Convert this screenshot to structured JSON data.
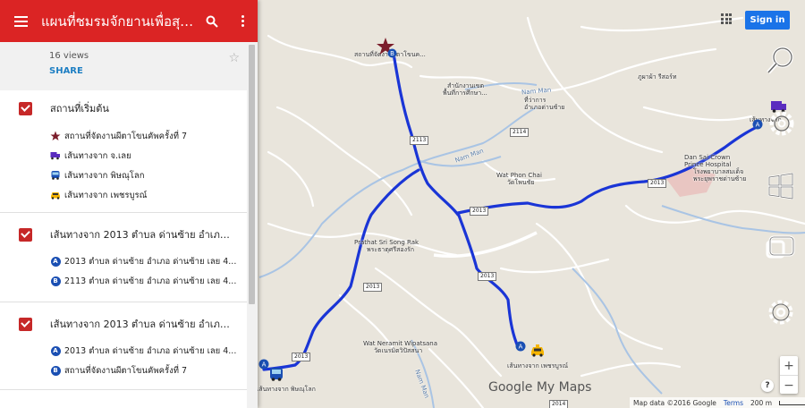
{
  "header": {
    "title": "แผนที่ชมรมจักยานเพื่อสุข...",
    "views": "16 views",
    "share": "SHARE"
  },
  "layers": [
    {
      "name": "สถานที่เริ่มต้น",
      "items": [
        {
          "label": "สถานที่จัดงานผีตาโขนคัพครั้งที่ 7",
          "icon": "star-icon"
        },
        {
          "label": "เส้นทางจาก จ.เลย",
          "icon": "truck-icon"
        },
        {
          "label": "เส้นทางจาก พิษณุโลก",
          "icon": "bus-icon"
        },
        {
          "label": "เส้นทางจาก เพชรบูรณ์",
          "icon": "taxi-icon"
        }
      ]
    },
    {
      "name": "เส้นทางจาก 2013 ตำบล ด่านซ้าย อำเภอ ...",
      "items": [
        {
          "badge": "A",
          "label": "2013 ตำบล ด่านซ้าย อำเภอ ด่านซ้าย เลย 4..."
        },
        {
          "badge": "B",
          "label": "2113 ตำบล ด่านซ้าย อำเภอ ด่านซ้าย เลย 4..."
        }
      ]
    },
    {
      "name": "เส้นทางจาก 2013 ตำบล ด่านซ้าย อำเภอ ...",
      "items": [
        {
          "badge": "A",
          "label": "2013 ตำบล ด่านซ้าย อำเภอ ด่านซ้าย เลย 4..."
        },
        {
          "badge": "B",
          "label": "สถานที่จัดงานผีตาโขนคัพครั้งที่ 7"
        }
      ]
    }
  ],
  "map": {
    "labels": {
      "venue": "สถานที่จัดงานผีตาโขนค...",
      "district_office_1": "สำนักงานเขต",
      "district_office_2": "พื้นที่การศึกษา...",
      "amphoe_1": "ที่ว่าการ",
      "amphoe_2": "อำเภอด่านซ้าย",
      "nam_man_1": "Nam Man",
      "nam_man_2": "Nam Man",
      "wat_phon_chai_1": "Wat Phon Chai",
      "wat_phon_chai_2": "วัดโพนชัย",
      "prathat_1": "Prathat Sri Song Rak",
      "prathat_2": "พระธาตุศรีสองรัก",
      "hospital_1": "Dan Sai Crown",
      "hospital_2": "Prince Hospital",
      "hospital_3": "โรงพยาบาลสมเด็จ",
      "hospital_4": "พระยุพราชด่านซ้าย",
      "wat_neramit_1": "Wat Neramit Wipatsana",
      "wat_neramit_2": "วัดเนรมิตวิปัสสนา",
      "phu_pha": "ภูผาผ้า รีสอร์ท",
      "route_loei": "เส้นทางจาก",
      "route_phitsanulok": "เส้นทางจาก พิษณุโลก",
      "route_phetchabun": "เส้นทางจาก เพชรบูรณ์",
      "nam_man_3": "Nam Man"
    },
    "shields": [
      "2113",
      "2114",
      "2013",
      "2013",
      "2013",
      "2013",
      "2013",
      "2014"
    ],
    "route_color": "#1a35d6",
    "brand": "Google My Maps"
  },
  "controls": {
    "sign_in": "Sign in",
    "zoom_in": "+",
    "zoom_out": "−",
    "help": "?"
  },
  "attribution": {
    "data": "Map data ©2016 Google",
    "terms": "Terms",
    "scale": "200 m"
  }
}
